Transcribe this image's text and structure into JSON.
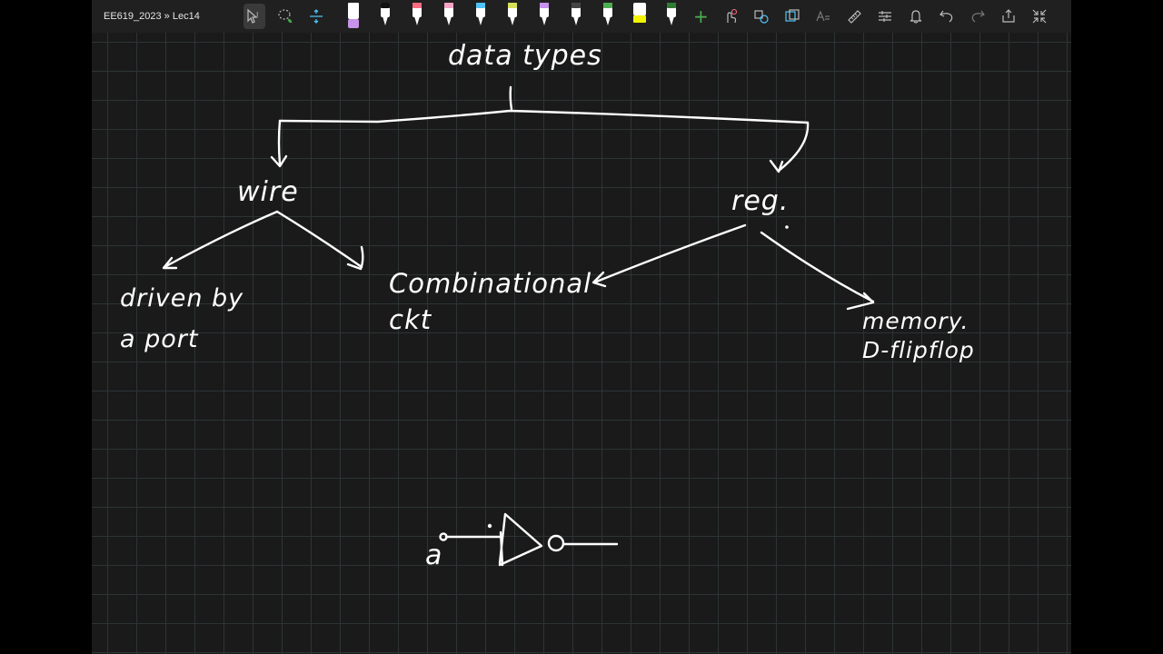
{
  "toolbar": {
    "breadcrumb": "EE619_2023 » Lec14",
    "pen_colors": [
      "#e6a020",
      "#ffffff",
      "#ff6b81",
      "#f5a3c7",
      "#4fc3f7",
      "#d4e157",
      "#c792ea",
      "#ffffff",
      "#4caf50",
      "#f5f500",
      "#4caf50"
    ],
    "icons": [
      "lasso-select-icon",
      "add-space-icon",
      "touch-draw-icon",
      "shape-icon",
      "ink-to-shape-icon",
      "ink-to-math-icon",
      "ruler-icon",
      "settings-sliders-icon",
      "bell-icon",
      "undo-icon",
      "redo-icon",
      "share-icon",
      "fullscreen-icon"
    ]
  },
  "notes": {
    "title": "data types",
    "left_node": "wire",
    "right_node": "reg.",
    "wire_child": "driven by\na port",
    "combinational": "Combinational\nckt",
    "memory": "memory.\nD-flipflop",
    "gate_input": "a"
  }
}
